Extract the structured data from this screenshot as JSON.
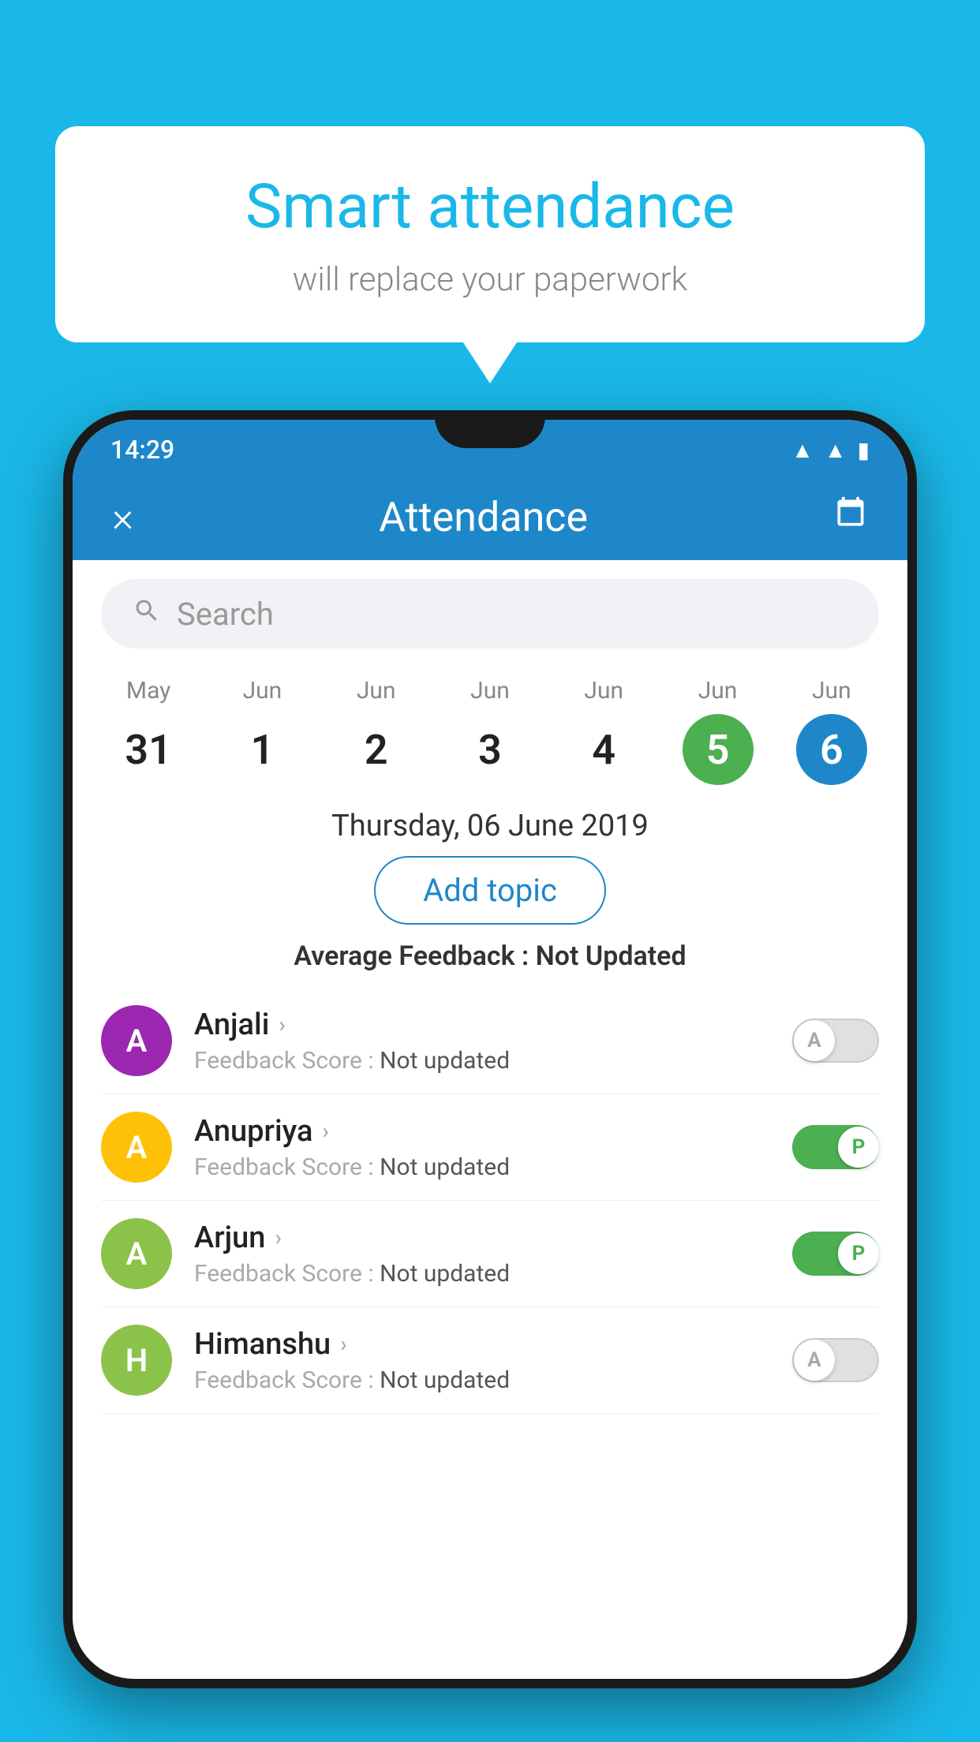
{
  "background_color": "#1ab8e8",
  "speech_bubble": {
    "title": "Smart attendance",
    "subtitle": "will replace your paperwork"
  },
  "status_bar": {
    "time": "14:29",
    "icons": [
      "wifi",
      "signal",
      "battery"
    ]
  },
  "header": {
    "title": "Attendance",
    "close_label": "×",
    "calendar_icon": "📅"
  },
  "search": {
    "placeholder": "Search"
  },
  "calendar": {
    "days": [
      {
        "month": "May",
        "day": "31",
        "style": "normal"
      },
      {
        "month": "Jun",
        "day": "1",
        "style": "normal"
      },
      {
        "month": "Jun",
        "day": "2",
        "style": "normal"
      },
      {
        "month": "Jun",
        "day": "3",
        "style": "normal"
      },
      {
        "month": "Jun",
        "day": "4",
        "style": "normal"
      },
      {
        "month": "Jun",
        "day": "5",
        "style": "green"
      },
      {
        "month": "Jun",
        "day": "6",
        "style": "blue"
      }
    ]
  },
  "selected_date": "Thursday, 06 June 2019",
  "add_topic_button": "Add topic",
  "avg_feedback_label": "Average Feedback : ",
  "avg_feedback_value": "Not Updated",
  "students": [
    {
      "name": "Anjali",
      "initial": "A",
      "avatar_color": "#9c27b0",
      "feedback_label": "Feedback Score : ",
      "feedback_value": "Not updated",
      "toggle": "off",
      "toggle_label": "A"
    },
    {
      "name": "Anupriya",
      "initial": "A",
      "avatar_color": "#ffc107",
      "feedback_label": "Feedback Score : ",
      "feedback_value": "Not updated",
      "toggle": "on",
      "toggle_label": "P"
    },
    {
      "name": "Arjun",
      "initial": "A",
      "avatar_color": "#8bc34a",
      "feedback_label": "Feedback Score : ",
      "feedback_value": "Not updated",
      "toggle": "on",
      "toggle_label": "P"
    },
    {
      "name": "Himanshu",
      "initial": "H",
      "avatar_color": "#8bc34a",
      "feedback_label": "Feedback Score : ",
      "feedback_value": "Not updated",
      "toggle": "off",
      "toggle_label": "A"
    }
  ]
}
